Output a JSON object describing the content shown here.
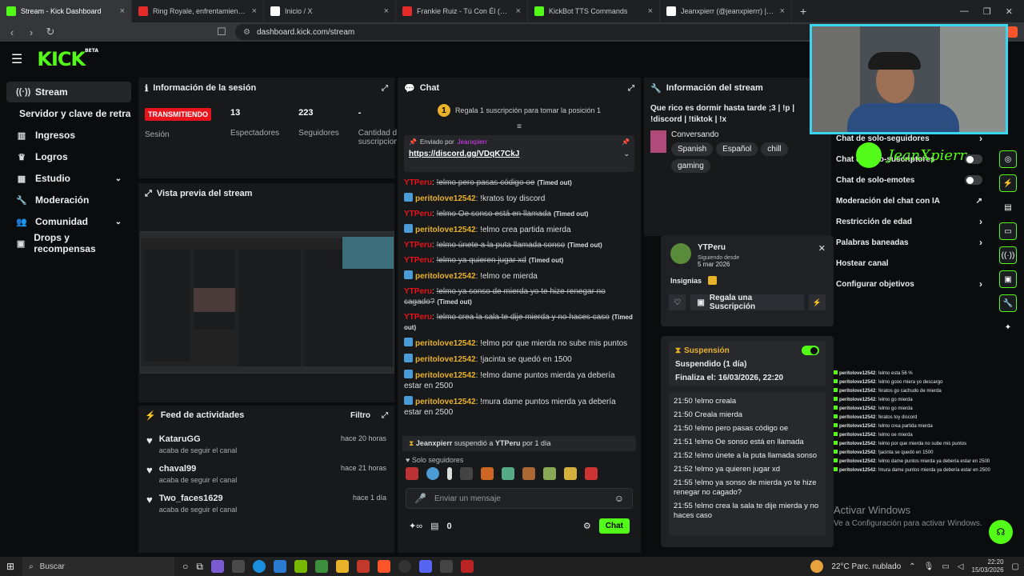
{
  "tabs": [
    {
      "title": "Stream - Kick Dashboard",
      "color": "#53fc18"
    },
    {
      "title": "Ring Royale, enfrentamientos EN VIV",
      "color": "#e62b2b"
    },
    {
      "title": "Inicio / X",
      "color": "#ffffff"
    },
    {
      "title": "Frankie Ruiz - Tú Con Él (Letra) -",
      "color": "#e62b2b"
    },
    {
      "title": "KickBot TTS Commands",
      "color": "#53fc18"
    },
    {
      "title": "Jeanxpierr (@jeanxpierrr) | TikTok",
      "color": "#ffffff"
    }
  ],
  "url": "dashboard.kick.com/stream",
  "logo": "KICK",
  "logo_beta": "BETA",
  "sidebar": {
    "items": [
      {
        "label": "Stream",
        "icon": "broadcast-icon"
      },
      {
        "label": "Servidor y clave de retransmisión",
        "icon": ""
      },
      {
        "label": "Ingresos",
        "icon": "chart-icon"
      },
      {
        "label": "Logros",
        "icon": "trophy-icon"
      },
      {
        "label": "Estudio",
        "icon": "grid-icon"
      },
      {
        "label": "Moderación",
        "icon": "wrench-icon"
      },
      {
        "label": "Comunidad",
        "icon": "people-icon"
      },
      {
        "label": "Drops y recompensas",
        "icon": "gift-icon"
      }
    ]
  },
  "session": {
    "title": "Información de la sesión",
    "badge": "TRANSMITIENDO",
    "label_session": "Sesión",
    "viewers": "13",
    "viewers_label": "Espectadores",
    "followers": "223",
    "followers_label": "Seguidores",
    "subs": "-",
    "subs_label": "Cantidad de suscripciones"
  },
  "preview": {
    "title": "Vista previa del stream"
  },
  "feed": {
    "title": "Feed de actividades",
    "filter": "Filtro",
    "items": [
      {
        "name": "KataruGG",
        "sub": "acaba de seguir el canal",
        "time": "hace 20 horas"
      },
      {
        "name": "chaval99",
        "sub": "acaba de seguir el canal",
        "time": "hace 21 horas"
      },
      {
        "name": "Two_faces1629",
        "sub": "acaba de seguir el canal",
        "time": "hace 1 día"
      }
    ]
  },
  "chat": {
    "title": "Chat",
    "gift_position": "1",
    "gift_text": "Regala 1 suscripción para tomar la posición 1",
    "pinned_label": "Enviado por",
    "pinned_user": "Jeanxpierr",
    "pinned_link": "https://discord.gg/VDqK7CkJ",
    "messages": [
      {
        "user": "YTPeru",
        "text": "!elmo pero pasas código oe",
        "timeout": "(Timed out)",
        "struck": true
      },
      {
        "user": "peritolove12542",
        "text": ": !kratos toy discord",
        "struck": false
      },
      {
        "user": "YTPeru",
        "text": "!elmo Oe sonso está en llamada",
        "timeout": "(Timed out)",
        "struck": true
      },
      {
        "user": "peritolove12542",
        "text": ": !elmo crea partida mierda",
        "struck": false
      },
      {
        "user": "YTPeru",
        "text": "!elmo únete a la puta llamada sonso",
        "timeout": "(Timed out)",
        "struck": true
      },
      {
        "user": "YTPeru",
        "text": "!elmo ya quieren jugar xd",
        "timeout": "(Timed out)",
        "struck": true
      },
      {
        "user": "peritolove12542",
        "text": ": !elmo oe mierda",
        "struck": false
      },
      {
        "user": "YTPeru",
        "text": "!elmo ya sonso de mierda yo te hize renegar no cagado?",
        "timeout": "(Timed out)",
        "struck": true
      },
      {
        "user": "YTPeru",
        "text": "!elmo crea la sala te dije mierda y no haces caso",
        "timeout": "(Timed out)",
        "struck": true
      },
      {
        "user": "peritolove12542",
        "text": ": !elmo por que mierda no sube mis puntos",
        "struck": false
      },
      {
        "user": "peritolove12542",
        "text": ": !jacinta se quedó en 1500",
        "struck": false
      },
      {
        "user": "peritolove12542",
        "text": ": !elmo dame puntos mierda ya debería estar en 2500",
        "struck": false
      },
      {
        "user": "peritolove12542",
        "text": ": !mura dame puntos mierda ya debería estar en 2500",
        "struck": false
      }
    ],
    "suspend_user": "Jeanxpierr",
    "suspend_text": "suspendió a",
    "suspend_target": "YTPeru",
    "suspend_duration": "por 1 día",
    "followers_only": "Solo seguidores",
    "placeholder": "Enviar un mensaje",
    "count": "0",
    "send": "Chat"
  },
  "info": {
    "title": "Información del stream",
    "stream_title": "Que rico es dormir hasta tarde ;3 | !p | !discord | !tiktok | !x",
    "category": "Conversando",
    "tags": [
      "Spanish",
      "Español",
      "chill",
      "gaming"
    ]
  },
  "settings": {
    "items": [
      {
        "label": "Chat de solo-seguidores",
        "type": "chevron"
      },
      {
        "label": "Chat de solo-suscriptores",
        "type": "toggle"
      },
      {
        "label": "Chat de solo-emotes",
        "type": "toggle"
      },
      {
        "label": "Moderación del chat con IA",
        "type": "link"
      },
      {
        "label": "Restricción de edad",
        "type": "chevron"
      },
      {
        "label": "Palabras baneadas",
        "type": "chevron"
      },
      {
        "label": "Hostear canal",
        "type": "none"
      },
      {
        "label": "Configurar objetivos",
        "type": "chevron"
      }
    ]
  },
  "user_card": {
    "name": "YTPeru",
    "following_label": "Siguiendo desde",
    "following_date": "5 mar 2026",
    "badges_label": "Insignias",
    "gift_button": "Regala una Suscripción"
  },
  "suspension": {
    "title": "Suspensión",
    "status": "Suspendido (1 día)",
    "ends": "Finaliza el: 16/03/2026, 22:20",
    "log": [
      "21:50 !elmo crealа",
      "21:50 Crealа mierda",
      "21:50 !elmo pero pasas código oe",
      "21:51 !elmo Oe sonso está en llamada",
      "21:52 !elmo únete a la puta llamada sonso",
      "21:52 !elmo ya quieren jugar xd",
      "21:55 !elmo ya sonso de mierda yo te hize renegar no cagado?",
      "21:55 !elmo crea la sala te dije mierda y no haces caso"
    ]
  },
  "webcam_name": "JeanXpierr",
  "overlay_chat": [
    {
      "user": "peritolove12542",
      "text": ": !elmo esta 56 %"
    },
    {
      "user": "peritolove12542",
      "text": ": !elmo gooo miera yo descargo"
    },
    {
      "user": "peritolove12542",
      "text": ": !kratos go cachudo de mierda"
    },
    {
      "user": "peritolove12542",
      "text": ": !elmo go mierda"
    },
    {
      "user": "peritolove12542",
      "text": ": !elmo go mierda"
    },
    {
      "user": "peritolove12542",
      "text": ": !kratos toy discord"
    },
    {
      "user": "peritolove12542",
      "text": ": !elmo crea partida mierda"
    },
    {
      "user": "peritolove12542",
      "text": ": !elmo oe mierda"
    },
    {
      "user": "peritolove12542",
      "text": ": !elmo por que mierda no sube mis puntos"
    },
    {
      "user": "peritolove12542",
      "text": ": !jacinta se quedó en 1500"
    },
    {
      "user": "peritolove12542",
      "text": ": !elmo dame puntos mierda ya debería estar en 2500"
    },
    {
      "user": "peritolove12542",
      "text": ": !mura dame puntos mierda ya debería estar en 2500"
    }
  ],
  "windows": {
    "activate_title": "Activar Windows",
    "activate_sub": "Ve a Configuración para activar Windows."
  },
  "taskbar": {
    "search": "Buscar",
    "weather": "22°C  Parc. nublado",
    "time": "22:20",
    "date": "15/03/2026"
  }
}
